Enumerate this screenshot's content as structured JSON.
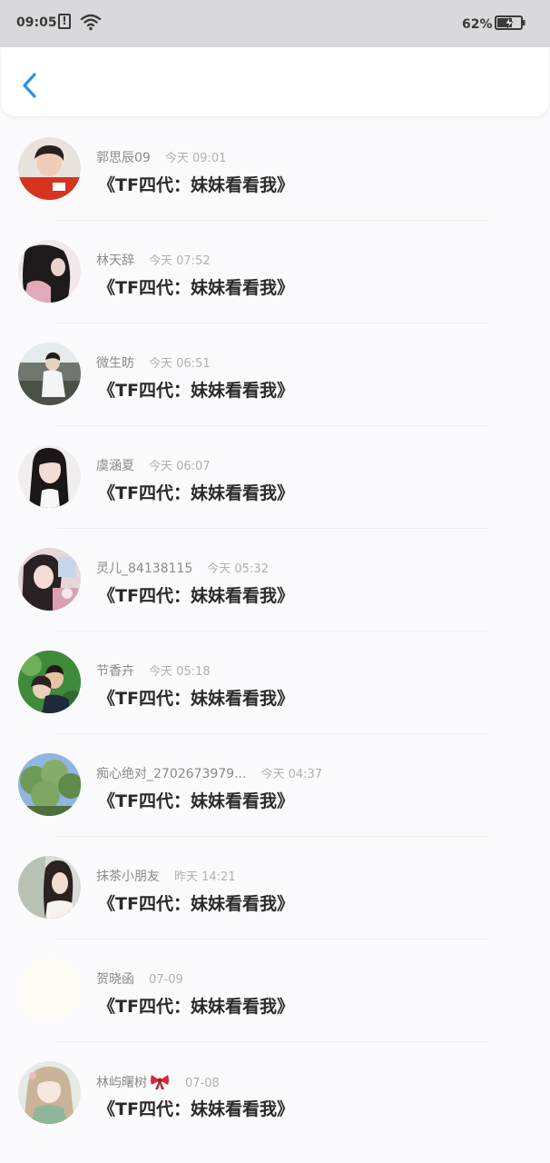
{
  "status_bar": {
    "time": "09:05",
    "alert_icon": "!",
    "battery_percent": "62%"
  },
  "nav": {
    "back_icon": "chevron-left-icon"
  },
  "comments": [
    {
      "user": "郭思辰09",
      "time": "今天 09:01",
      "text": "《TF四代：妹妹看看我》",
      "avatar": "photo"
    },
    {
      "user": "林天辞",
      "time": "今天 07:52",
      "text": "《TF四代：妹妹看看我》",
      "avatar": "photo"
    },
    {
      "user": "微生昉",
      "time": "今天 06:51",
      "text": "《TF四代：妹妹看看我》",
      "avatar": "photo"
    },
    {
      "user": "虞涵夏",
      "time": "今天 06:07",
      "text": "《TF四代：妹妹看看我》",
      "avatar": "photo"
    },
    {
      "user": "灵儿_84138115",
      "time": "今天 05:32",
      "text": "《TF四代：妹妹看看我》",
      "avatar": "photo"
    },
    {
      "user": "节香卉",
      "time": "今天 05:18",
      "text": "《TF四代：妹妹看看我》",
      "avatar": "photo"
    },
    {
      "user": "痴心绝对_2702673979...",
      "time": "今天 04:37",
      "text": "《TF四代：妹妹看看我》",
      "avatar": "photo"
    },
    {
      "user": "抹茶小朋友",
      "time": "昨天 14:21",
      "text": "《TF四代：妹妹看看我》",
      "avatar": "photo"
    },
    {
      "user": "贺晓函",
      "time": "07-09",
      "text": "《TF四代：妹妹看看我》",
      "avatar": "blank"
    },
    {
      "user": "林屿曙树",
      "time": "07-08",
      "text": "《TF四代：妹妹看看我》",
      "avatar": "photo",
      "badge_icon": "ribbon-bow-icon"
    }
  ],
  "colors": {
    "accent": "#2b8ff0",
    "status_bar_bg": "#d9d9db",
    "page_bg": "#fbfbfd"
  }
}
